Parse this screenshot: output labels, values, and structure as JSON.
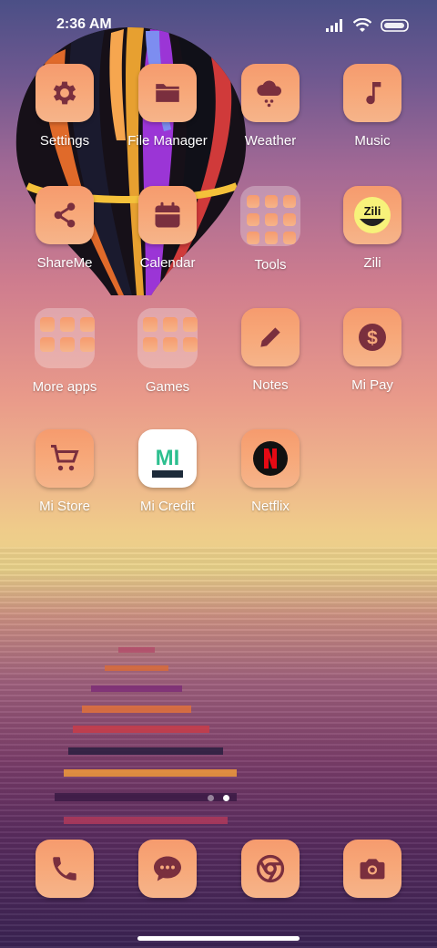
{
  "status_bar": {
    "time": "2:36 AM"
  },
  "apps": [
    {
      "label": "Settings",
      "icon": "gear-icon"
    },
    {
      "label": "File Manager",
      "icon": "folder-icon"
    },
    {
      "label": "Weather",
      "icon": "cloud-rain-icon"
    },
    {
      "label": "Music",
      "icon": "music-note-icon"
    },
    {
      "label": "ShareMe",
      "icon": "share-icon"
    },
    {
      "label": "Calendar",
      "icon": "calendar-icon"
    },
    {
      "label": "Tools",
      "icon": "tools-folder-icon"
    },
    {
      "label": "Zili",
      "icon": "zili-logo-icon"
    },
    {
      "label": "More apps",
      "icon": "more-apps-folder-icon"
    },
    {
      "label": "Games",
      "icon": "games-folder-icon"
    },
    {
      "label": "Notes",
      "icon": "pencil-icon"
    },
    {
      "label": "Mi Pay",
      "icon": "dollar-coin-icon"
    },
    {
      "label": "Mi Store",
      "icon": "shopping-cart-icon"
    },
    {
      "label": "Mi Credit",
      "icon": "mi-credit-logo-icon"
    },
    {
      "label": "Netflix",
      "icon": "netflix-logo-icon"
    }
  ],
  "page_indicator": {
    "pages": 2,
    "active": 2
  },
  "dock": [
    {
      "name": "phone",
      "icon": "phone-icon"
    },
    {
      "name": "messages",
      "icon": "message-icon"
    },
    {
      "name": "browser",
      "icon": "chrome-icon"
    },
    {
      "name": "camera",
      "icon": "camera-icon"
    }
  ],
  "colors": {
    "icon_bg_top": "#f69b6e",
    "icon_bg_bottom": "#f6b48a",
    "icon_glyph": "#7a2f3e"
  }
}
